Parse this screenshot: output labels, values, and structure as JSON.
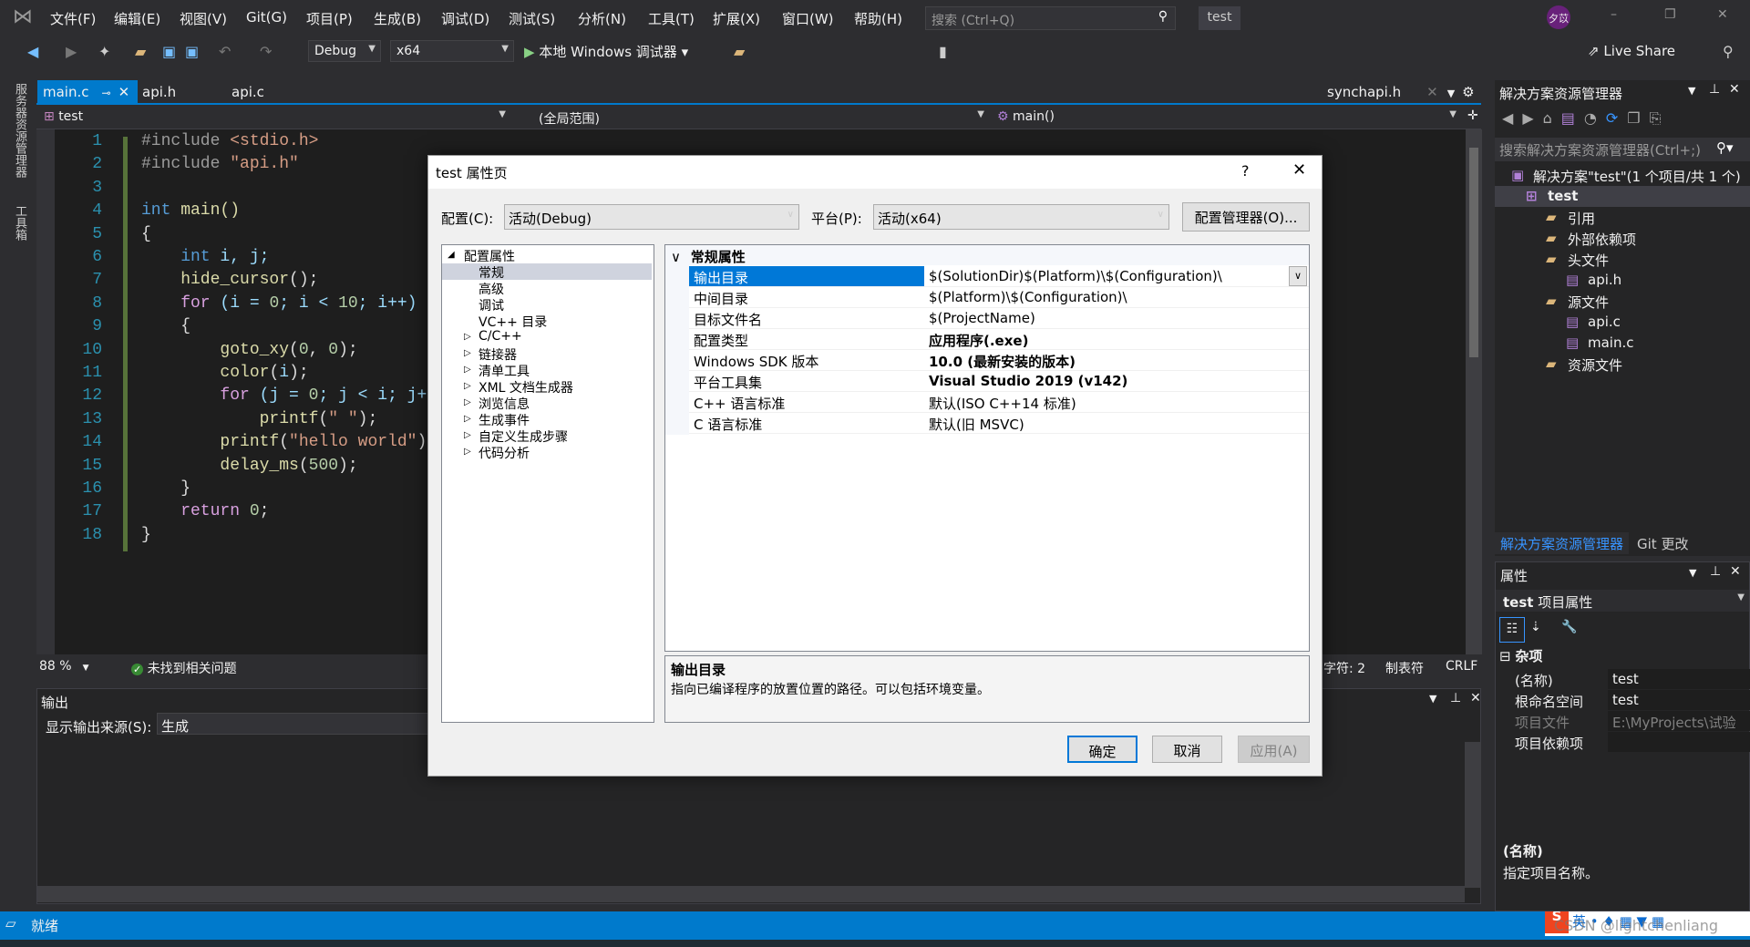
{
  "menubar": {
    "items": [
      "文件(F)",
      "编辑(E)",
      "视图(V)",
      "Git(G)",
      "项目(P)",
      "生成(B)",
      "调试(D)",
      "测试(S)",
      "分析(N)",
      "工具(T)",
      "扩展(X)",
      "窗口(W)",
      "帮助(H)"
    ],
    "search_placeholder": "搜索 (Ctrl+Q)",
    "solution_name": "test",
    "avatar": "夕苡"
  },
  "toolbar": {
    "configuration": "Debug",
    "platform": "x64",
    "run_label": "本地 Windows 调试器",
    "live_share": "Live Share"
  },
  "left_strip": {
    "tabs": [
      "服务器资源管理器",
      "工具箱"
    ]
  },
  "tabs": [
    {
      "label": "main.c",
      "active": true
    },
    {
      "label": "api.h"
    },
    {
      "label": "api.c"
    }
  ],
  "preview_tab": "synchapi.h",
  "navbar": {
    "project": "test",
    "scope": "(全局范围)",
    "member": "main()"
  },
  "code": {
    "line_numbers": [
      "1",
      "2",
      "3",
      "4",
      "5",
      "6",
      "7",
      "8",
      "9",
      "10",
      "11",
      "12",
      "13",
      "14",
      "15",
      "16",
      "17",
      "18"
    ],
    "lines": [
      [
        [
          "#include ",
          "pp"
        ],
        [
          "<stdio.h>",
          "str"
        ]
      ],
      [
        [
          "#include ",
          "pp"
        ],
        [
          "\"api.h\"",
          "str"
        ]
      ],
      [],
      [
        [
          "int",
          "kw"
        ],
        [
          " main()",
          "fn"
        ]
      ],
      [
        [
          "{",
          ""
        ]
      ],
      [
        [
          "    int",
          "kw"
        ],
        [
          " i, j;",
          "var"
        ]
      ],
      [
        [
          "    hide_cursor",
          "fn"
        ],
        [
          "();",
          ""
        ]
      ],
      [
        [
          "    for",
          "ctl"
        ],
        [
          " (i = ",
          "var"
        ],
        [
          "0",
          "num"
        ],
        [
          "; i < ",
          "var"
        ],
        [
          "10",
          "num"
        ],
        [
          "; i++)",
          "var"
        ]
      ],
      [
        [
          "    {",
          ""
        ]
      ],
      [
        [
          "        goto_xy",
          "fn"
        ],
        [
          "(",
          ""
        ],
        [
          "0",
          "num"
        ],
        [
          ", ",
          ""
        ],
        [
          "0",
          "num"
        ],
        [
          ");",
          ""
        ]
      ],
      [
        [
          "        color",
          "fn"
        ],
        [
          "(",
          ""
        ],
        [
          "i",
          "var"
        ],
        [
          ");",
          ""
        ]
      ],
      [
        [
          "        for",
          "ctl"
        ],
        [
          " (j = ",
          "var"
        ],
        [
          "0",
          "num"
        ],
        [
          "; j < i; j++)",
          "var"
        ]
      ],
      [
        [
          "            printf",
          "fn"
        ],
        [
          "(",
          ""
        ],
        [
          "\" \"",
          "str"
        ],
        [
          ");",
          ""
        ]
      ],
      [
        [
          "        printf",
          "fn"
        ],
        [
          "(",
          ""
        ],
        [
          "\"hello world\"",
          "str"
        ],
        [
          ");",
          ""
        ]
      ],
      [
        [
          "        delay_ms",
          "fn"
        ],
        [
          "(",
          ""
        ],
        [
          "500",
          "num"
        ],
        [
          ");",
          ""
        ]
      ],
      [
        [
          "    }",
          ""
        ]
      ],
      [
        [
          "    return",
          "ctl"
        ],
        [
          " ",
          ""
        ],
        [
          "0",
          "num"
        ],
        [
          ";",
          ""
        ]
      ],
      [
        [
          "}",
          ""
        ]
      ]
    ]
  },
  "editor_status": {
    "zoom": "88 %",
    "issues": "未找到相关问题",
    "char": "字符: 2",
    "indent": "制表符",
    "eol": "CRLF"
  },
  "output": {
    "title": "输出",
    "source_label": "显示输出来源(S):",
    "source_value": "生成"
  },
  "statusbar": {
    "text": "就绪",
    "watermark": "CSDN @lightchenliang",
    "ime": "英"
  },
  "solution_explorer": {
    "title": "解决方案资源管理器",
    "search_placeholder": "搜索解决方案资源管理器(Ctrl+;)",
    "items": [
      {
        "label": "解决方案\"test\"(1 个项目/共 1 个)",
        "level": 0
      },
      {
        "label": "test",
        "level": 1,
        "selected": true
      },
      {
        "label": "引用",
        "level": 2
      },
      {
        "label": "外部依赖项",
        "level": 2
      },
      {
        "label": "头文件",
        "level": 2
      },
      {
        "label": "api.h",
        "level": 3
      },
      {
        "label": "源文件",
        "level": 2
      },
      {
        "label": "api.c",
        "level": 3
      },
      {
        "label": "main.c",
        "level": 3
      },
      {
        "label": "资源文件",
        "level": 2
      }
    ],
    "bottom_tabs": [
      "解决方案资源管理器",
      "Git 更改"
    ]
  },
  "properties": {
    "title": "属性",
    "object_name": "test",
    "object_type": "项目属性",
    "category": "杂项",
    "rows": [
      {
        "name": "(名称)",
        "value": "test"
      },
      {
        "name": "根命名空间",
        "value": "test"
      },
      {
        "name": "项目文件",
        "value": "E:\\MyProjects\\试验"
      },
      {
        "name": "项目依赖项",
        "value": ""
      }
    ],
    "desc_title": "(名称)",
    "desc_text": "指定项目名称。"
  },
  "dialog": {
    "title": "test 属性页",
    "help": "?",
    "config_label": "配置(C):",
    "config_value": "活动(Debug)",
    "platform_label": "平台(P):",
    "platform_value": "活动(x64)",
    "config_manager": "配置管理器(O)...",
    "tree": [
      {
        "label": "配置属性",
        "level": 0,
        "expanded": true
      },
      {
        "label": "常规",
        "level": 1,
        "selected": true
      },
      {
        "label": "高级",
        "level": 1
      },
      {
        "label": "调试",
        "level": 1
      },
      {
        "label": "VC++ 目录",
        "level": 1
      },
      {
        "label": "C/C++",
        "level": 1,
        "expandable": true
      },
      {
        "label": "链接器",
        "level": 1,
        "expandable": true
      },
      {
        "label": "清单工具",
        "level": 1,
        "expandable": true
      },
      {
        "label": "XML 文档生成器",
        "level": 1,
        "expandable": true
      },
      {
        "label": "浏览信息",
        "level": 1,
        "expandable": true
      },
      {
        "label": "生成事件",
        "level": 1,
        "expandable": true
      },
      {
        "label": "自定义生成步骤",
        "level": 1,
        "expandable": true
      },
      {
        "label": "代码分析",
        "level": 1,
        "expandable": true
      }
    ],
    "group": "常规属性",
    "props": [
      {
        "name": "输出目录",
        "value": "$(SolutionDir)$(Platform)\\$(Configuration)\\",
        "selected": true
      },
      {
        "name": "中间目录",
        "value": "$(Platform)\\$(Configuration)\\"
      },
      {
        "name": "目标文件名",
        "value": "$(ProjectName)"
      },
      {
        "name": "配置类型",
        "value": "应用程序(.exe)",
        "bold": true
      },
      {
        "name": "Windows SDK 版本",
        "value": "10.0 (最新安装的版本)",
        "bold": true
      },
      {
        "name": "平台工具集",
        "value": "Visual Studio 2019 (v142)",
        "bold": true
      },
      {
        "name": "C++ 语言标准",
        "value": "默认(ISO C++14 标准)"
      },
      {
        "name": "C 语言标准",
        "value": "默认(旧 MSVC)"
      }
    ],
    "desc_title": "输出目录",
    "desc_text": "指向已编译程序的放置位置的路径。可以包括环境变量。",
    "ok": "确定",
    "cancel": "取消",
    "apply": "应用(A)"
  },
  "colors": {
    "accent": "#007acc",
    "selection": "#0078d7",
    "editor_bg": "#1e1e1e"
  }
}
